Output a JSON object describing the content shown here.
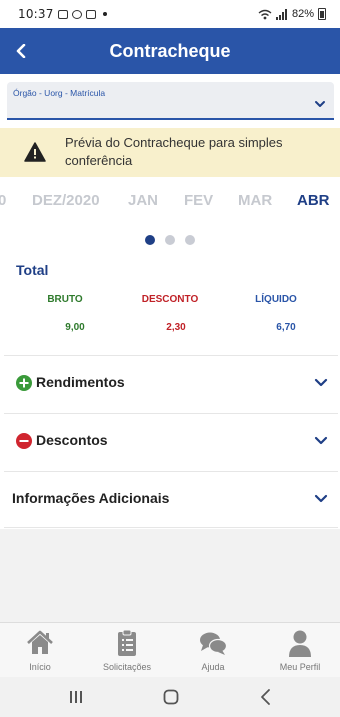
{
  "status_bar": {
    "time": "10:37",
    "battery": "82%"
  },
  "app_bar": {
    "title": "Contracheque",
    "back_icon": "chevron-left-icon"
  },
  "select": {
    "label": "Órgão - Uorg - Matrícula",
    "value": ""
  },
  "notice": {
    "icon": "warning-icon",
    "text": "Prévia do Contracheque para simples conferência"
  },
  "months": [
    "0",
    "DEZ/2020",
    "JAN",
    "FEV",
    "MAR",
    "ABR"
  ],
  "active_month": "ABR",
  "pager": {
    "count": 3,
    "active_index": 0
  },
  "total": {
    "title": "Total",
    "columns": [
      {
        "label": "BRUTO",
        "value": "9,00",
        "color": "#2e7a2c"
      },
      {
        "label": "DESCONTO",
        "value": "2,30",
        "color": "#c02127"
      },
      {
        "label": "LÍQUIDO",
        "value": "6,70",
        "color": "#2a55a8"
      }
    ]
  },
  "sections": [
    {
      "label": "Rendimentos",
      "icon": "plus-circle-icon",
      "icon_color": "#3a9a3a"
    },
    {
      "label": "Descontos",
      "icon": "minus-circle-icon",
      "icon_color": "#d0252f"
    },
    {
      "label": "Informações Adicionais",
      "icon": "",
      "icon_color": ""
    }
  ],
  "bottom_nav": [
    {
      "label": "Início",
      "icon": "home-icon"
    },
    {
      "label": "Solicitações",
      "icon": "clipboard-icon"
    },
    {
      "label": "Ajuda",
      "icon": "chat-bubbles-icon"
    },
    {
      "label": "Meu Perfil",
      "icon": "user-icon"
    }
  ],
  "colors": {
    "primary": "#2a55a8",
    "primary_dark": "#1f3f86",
    "notice_bg": "#f8f0cc"
  }
}
